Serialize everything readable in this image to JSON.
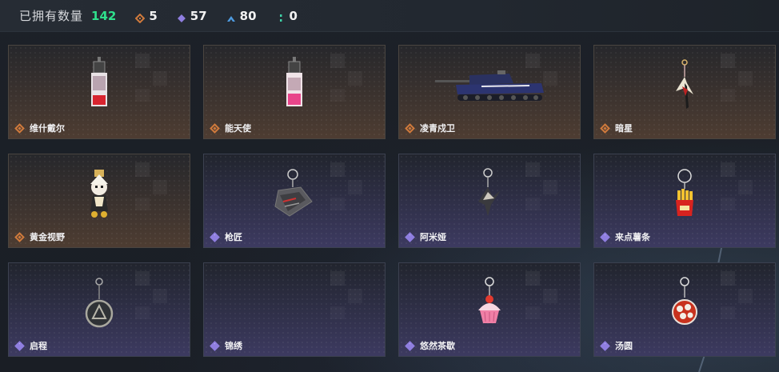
{
  "header": {
    "owned_label": "已拥有数量",
    "owned_count": "142",
    "stats": [
      {
        "icon": "gold-diamond-icon",
        "value": "5",
        "color": "#d07a3c"
      },
      {
        "icon": "purple-diamond-icon",
        "value": "57",
        "color": "#8f7ee0"
      },
      {
        "icon": "blue-chevron-icon",
        "value": "80",
        "color": "#4e9be0"
      },
      {
        "icon": "green-dots-icon",
        "value": "0",
        "color": "#3fd0a6"
      }
    ]
  },
  "items": [
    {
      "name": "维什戴尔",
      "rarity": "gold",
      "art": "vial-keychain"
    },
    {
      "name": "能天使",
      "rarity": "gold",
      "art": "vial-keychain-pink"
    },
    {
      "name": "凌青戍卫",
      "rarity": "gold",
      "art": "tank"
    },
    {
      "name": "暗星",
      "rarity": "gold",
      "art": "bird-charm"
    },
    {
      "name": "黄金视野",
      "rarity": "gold",
      "art": "figure-charm"
    },
    {
      "name": "枪匠",
      "rarity": "purple",
      "art": "tag-charm"
    },
    {
      "name": "阿米娅",
      "rarity": "purple",
      "art": "ears-charm"
    },
    {
      "name": "来点薯条",
      "rarity": "purple",
      "art": "fries-charm"
    },
    {
      "name": "启程",
      "rarity": "purple",
      "art": "ring-charm"
    },
    {
      "name": "锦绣",
      "rarity": "purple",
      "art": "empty"
    },
    {
      "name": "悠然茶歇",
      "rarity": "purple",
      "art": "cupcake-charm"
    },
    {
      "name": "汤圆",
      "rarity": "purple",
      "art": "bowl-charm"
    }
  ]
}
